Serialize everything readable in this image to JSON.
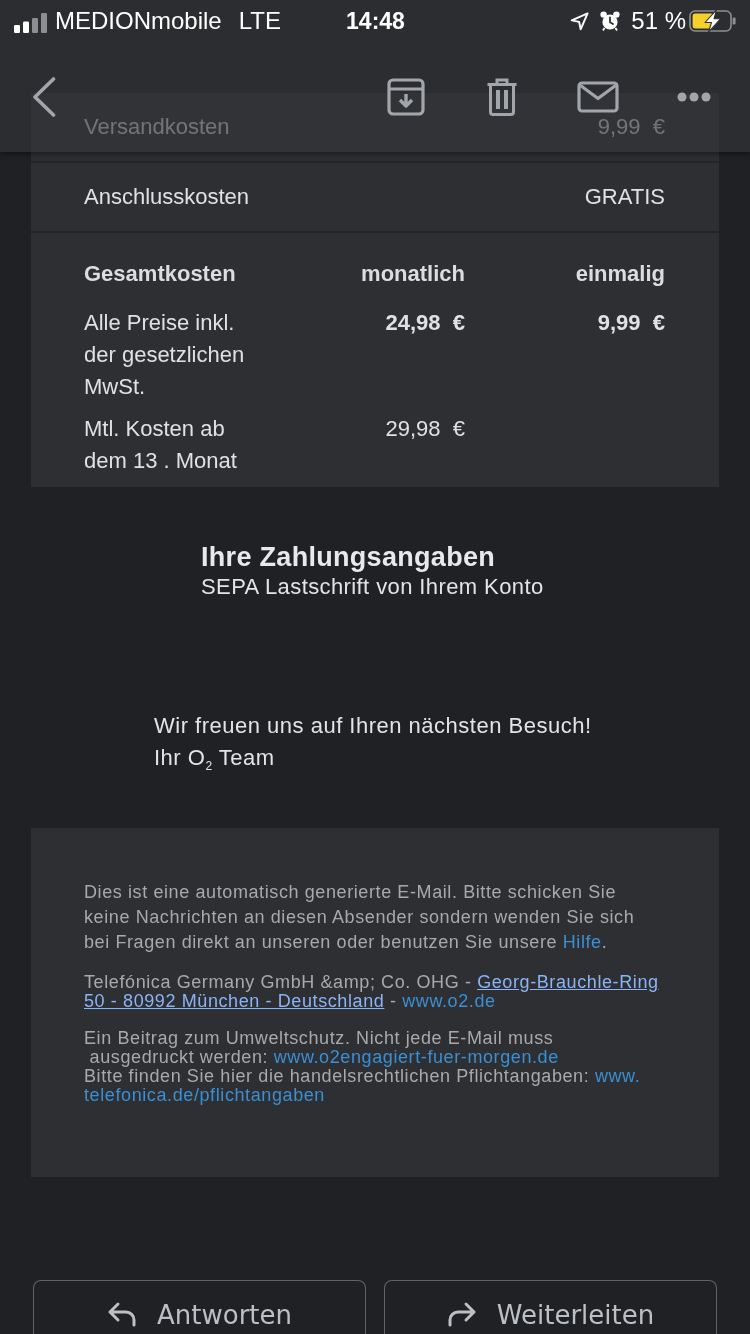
{
  "status_bar": {
    "carrier": "MEDIONmobile",
    "network": "LTE",
    "time": "14:48",
    "battery": "51 %"
  },
  "cost_rows": [
    {
      "label": "Versandkosten",
      "value": "9,99  €"
    },
    {
      "label": "Anschlusskosten",
      "value": "GRATIS"
    }
  ],
  "cost_table": {
    "columns": [
      "Gesamtkosten",
      "monatlich",
      "einmalig"
    ],
    "rows": [
      {
        "kind": "total",
        "label": "Alle Preise inkl. der gesetzlichen MwSt.",
        "monthly": "24,98  €",
        "one_time": "9,99  €"
      },
      {
        "kind": "plain",
        "label": "Mtl. Kosten ab dem 13 . Monat",
        "monthly": "29,98  €"
      }
    ]
  },
  "payment": {
    "title": "Ihre Zahlungsangaben",
    "method": "SEPA Lastschrift von Ihrem Konto"
  },
  "closing": {
    "greeting": "Wir freuen uns auf Ihren nächsten Besuch!",
    "signature": "Ihr O$_{2}$ Team"
  },
  "footer": {
    "paragraphs": [
      {
        "kind": "notice",
        "lines": [
          [
            {
              "kind": "text",
              "text": "Dies ist eine automatisch generierte E-Mail. Bitte schicken Sie"
            }
          ],
          [
            {
              "kind": "text",
              "text": "keine Nachrichten an diesen Absender sondern wenden Sie sich"
            }
          ],
          [
            {
              "kind": "text",
              "text": "bei Fragen direkt an unseren oder benutzen Sie unsere "
            },
            {
              "kind": "link",
              "text": "Hilfe"
            },
            {
              "kind": "text",
              "text": "."
            }
          ]
        ]
      },
      {
        "kind": "legal",
        "lines": [
          [
            {
              "kind": "text",
              "text": "Telefónica Germany GmbH &amp; Co. OHG - "
            },
            {
              "kind": "underlined_link",
              "text": "Georg-Brauchle-Ring"
            }
          ],
          [
            {
              "kind": "underlined_link",
              "text": "50 - 80992 München - Deutschland"
            },
            {
              "kind": "text",
              "text": " - "
            },
            {
              "kind": "link",
              "text": "www.o2.de"
            }
          ]
        ]
      },
      {
        "kind": "legal",
        "lines": [
          [
            {
              "kind": "text",
              "text": "Ein Beitrag zum Umweltschutz. Nicht jede E-Mail muss"
            }
          ],
          [
            {
              "kind": "text",
              "text": " ausgedruckt werden: "
            },
            {
              "kind": "link",
              "text": "www.o2engagiert-fuer-morgen.de"
            }
          ],
          [
            {
              "kind": "text",
              "text": "Bitte finden Sie hier die handelsrechtlichen Pflichtangaben: "
            },
            {
              "kind": "link",
              "text": "www."
            }
          ],
          [
            {
              "kind": "link",
              "text": "telefonica.de/pflichtangaben"
            }
          ]
        ]
      }
    ]
  },
  "actions": [
    {
      "kind": "reply",
      "label": "Antworten"
    },
    {
      "kind": "forward",
      "label": "Weiterleiten"
    }
  ]
}
